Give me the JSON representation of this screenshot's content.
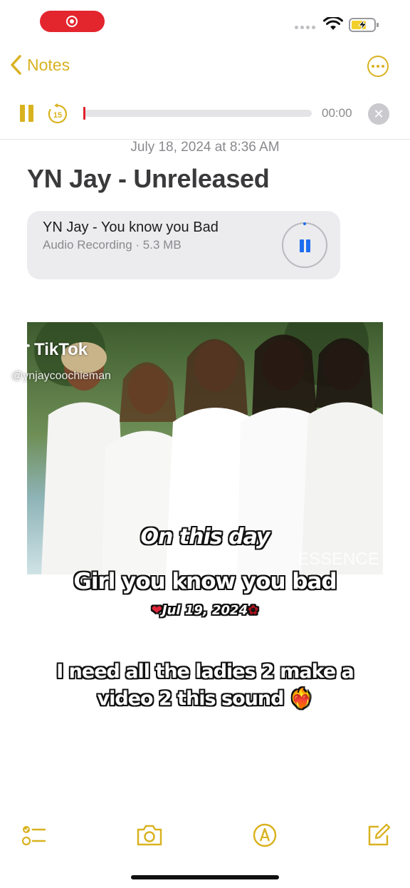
{
  "status_bar": {
    "recording_indicator": "record-icon",
    "battery_charging": true
  },
  "nav": {
    "back_label": "Notes",
    "more_icon": "ellipsis-circle-icon"
  },
  "player": {
    "time": "00:00",
    "skip_label": "15",
    "progress": 0
  },
  "note": {
    "date": "July 18, 2024 at 8:36 AM",
    "title": "YN Jay - Unreleased",
    "attachment": {
      "title": "YN Jay - You know you Bad",
      "subtitle": "Audio Recording · 5.3 MB"
    }
  },
  "overlay": {
    "tiktok_logo": "TikTok",
    "tiktok_user": "@ynjaycoochieman",
    "photo_brand": "ESSENCE",
    "caption1": "On this day",
    "caption2": "Girl you know you bad",
    "caption3": "Jul 19, 2024",
    "caption4": "I need all the ladies 2 make a video 2 this sound ❤️‍🔥"
  },
  "toolbar": {
    "items": [
      "checklist-icon",
      "camera-icon",
      "markup-icon",
      "compose-icon"
    ]
  },
  "colors": {
    "accent": "#d9b220",
    "record_red": "#e3262e",
    "play_blue": "#1d6ef0"
  }
}
